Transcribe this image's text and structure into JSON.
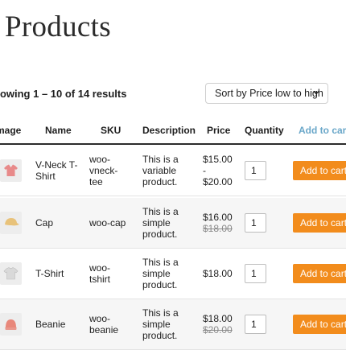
{
  "page": {
    "title": "Products"
  },
  "results": {
    "count_text": "howing 1 – 10 of 14 results"
  },
  "sort": {
    "selected": "Sort by Price low to high"
  },
  "table": {
    "headers": {
      "image": "mage",
      "name": "Name",
      "sku": "SKU",
      "description": "Description",
      "price": "Price",
      "quantity": "Quantity",
      "add_to_cart": "Add to cart"
    },
    "rows": [
      {
        "name_lines": [
          "V-Neck T-",
          "Shirt"
        ],
        "sku_lines": [
          "woo-",
          "vneck-",
          "tee"
        ],
        "description_lines": [
          "This is a",
          "variable",
          "product."
        ],
        "price_lines": [
          "$15.00",
          "-",
          "$20.00"
        ],
        "old_price": "",
        "quantity": "1",
        "button_label": "Add to cart",
        "image_icon": "vneck-shirt-icon",
        "image_color": "#e88a8a"
      },
      {
        "name_lines": [
          "Cap"
        ],
        "sku_lines": [
          "woo-cap"
        ],
        "description_lines": [
          "This is a",
          "simple",
          "product."
        ],
        "price_lines": [
          "$16.00"
        ],
        "old_price": "$18.00",
        "quantity": "1",
        "button_label": "Add to cart",
        "image_icon": "cap-icon",
        "image_color": "#e8c27a"
      },
      {
        "name_lines": [
          "T-Shirt"
        ],
        "sku_lines": [
          "woo-",
          "tshirt"
        ],
        "description_lines": [
          "This is a",
          "simple",
          "product."
        ],
        "price_lines": [
          "$18.00"
        ],
        "old_price": "",
        "quantity": "1",
        "button_label": "Add to cart",
        "image_icon": "tshirt-icon",
        "image_color": "#d9d9d9"
      },
      {
        "name_lines": [
          "Beanie"
        ],
        "sku_lines": [
          "woo-",
          "beanie"
        ],
        "description_lines": [
          "This is a",
          "simple",
          "product."
        ],
        "price_lines": [
          "$18.00"
        ],
        "old_price": "$20.00",
        "quantity": "1",
        "button_label": "Add to cart",
        "image_icon": "beanie-icon",
        "image_color": "#e8877a"
      }
    ]
  },
  "colors": {
    "button": "#f28c1c",
    "cart_header": "#6aa7c9"
  }
}
